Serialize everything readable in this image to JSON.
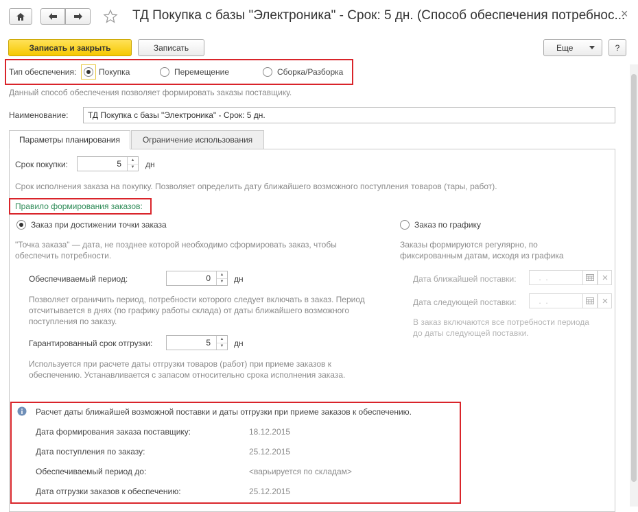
{
  "window": {
    "title": "ТД Покупка с базы \"Электроника\" - Срок: 5 дн. (Способ обеспечения потребнос...",
    "close_glyph": "×"
  },
  "toolbar": {
    "save_close_label": "Записать и закрыть",
    "save_label": "Записать",
    "more_label": "Еще",
    "help_label": "?"
  },
  "supply_type": {
    "label": "Тип обеспечения:",
    "options": [
      "Покупка",
      "Перемещение",
      "Сборка/Разборка"
    ],
    "selected": "Покупка",
    "hint": "Данный способ обеспечения позволяет формировать заказы поставщику."
  },
  "name": {
    "label": "Наименование:",
    "value": "ТД Покупка с базы \"Электроника\" - Срок: 5 дн."
  },
  "tabs": [
    {
      "label": "Параметры планирования",
      "active": true
    },
    {
      "label": "Ограничение использования",
      "active": false
    }
  ],
  "planning": {
    "purchase_term_label": "Срок покупки:",
    "purchase_term_value": "5",
    "days_unit": "дн",
    "purchase_term_hint": "Срок исполнения заказа на покупку. Позволяет определить дату ближайшего возможного поступления товаров (тары, работ).",
    "rule_label": "Правило формирования заказов:",
    "rule_reorder_label": "Заказ при достижении точки заказа",
    "rule_schedule_label": "Заказ по графику",
    "reorder_hint_1": "\"Точка заказа\" — дата, не позднее которой необходимо сформировать заказ, чтобы",
    "reorder_hint_2": "обеспечить потребности.",
    "schedule_hint_1": "Заказы формируются регулярно, по",
    "schedule_hint_2": "фиксированным датам, исходя из графика",
    "period_label": "Обеспечиваемый период:",
    "period_value": "0",
    "period_hint_1": "Позволяет ограничить период, потребности которого следует включать в заказ. Период",
    "period_hint_2": "отсчитывается в днях (по графику работы склада) от даты ближайшего возможного",
    "period_hint_3": "поступления по заказу.",
    "guaranteed_label": "Гарантированный срок отгрузки:",
    "guaranteed_value": "5",
    "guaranteed_hint_1": "Используется при расчете даты отгрузки товаров (работ) при приеме заказов к",
    "guaranteed_hint_2": "обеспечению. Устанавливается с запасом относительно срока исполнения заказа.",
    "next_delivery_label": "Дата ближайшей поставки:",
    "following_delivery_label": "Дата следующей поставки:",
    "date_placeholder": " .  .",
    "schedule_note_1": "В заказ включаются все потребности периода",
    "schedule_note_2": "до даты следующей поставки."
  },
  "calc": {
    "header": "Расчет даты ближайшей возможной поставки и даты отгрузки при приеме заказов к обеспечению.",
    "rows": [
      {
        "label": "Дата формирования заказа поставщику:",
        "value": "18.12.2015"
      },
      {
        "label": "Дата поступления по заказу:",
        "value": "25.12.2015"
      },
      {
        "label": "Обеспечиваемый период до:",
        "value": "<варьируется по складам>"
      },
      {
        "label": "Дата отгрузки заказов к обеспечению:",
        "value": "25.12.2015"
      }
    ]
  },
  "colors": {
    "accent_yellow": "#f6c800",
    "highlight_red": "#d9242a",
    "rule_green": "#2e8b57"
  }
}
